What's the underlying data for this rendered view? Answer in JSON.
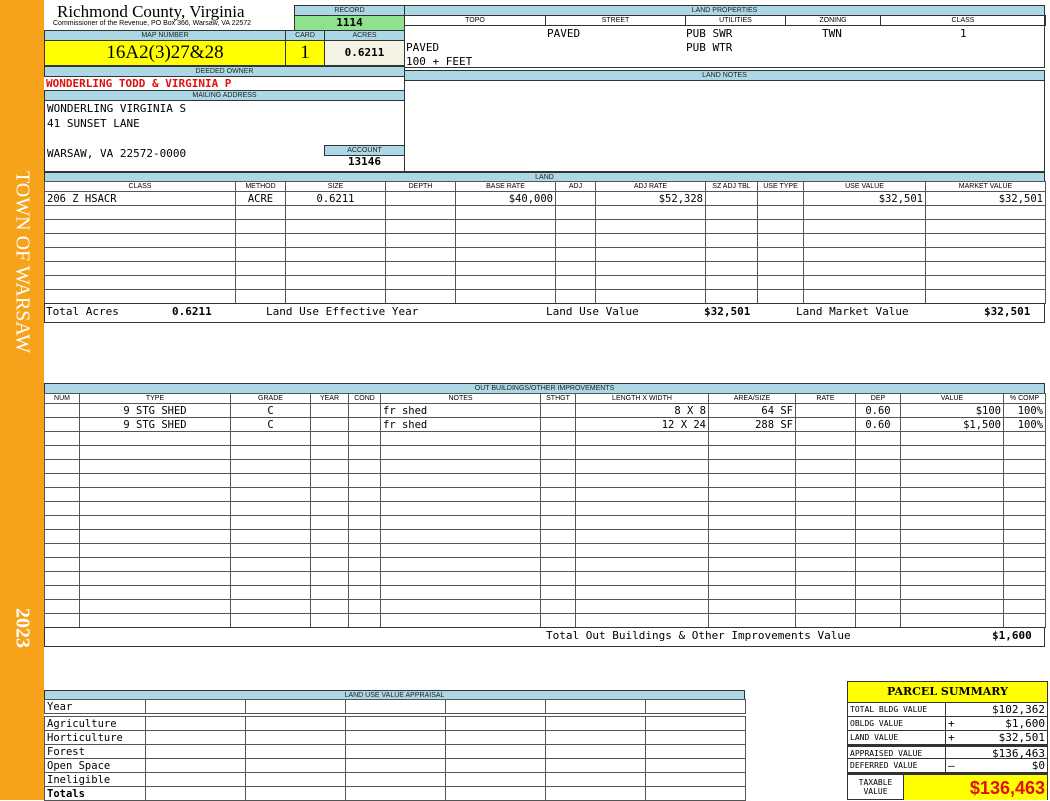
{
  "sidebar": {
    "town": "TOWN OF WARSAW",
    "year": "2023",
    "color": "#f7a21b"
  },
  "header": {
    "county": "Richmond County, Virginia",
    "subtitle": "Commissioner of the Revenue, PO Box 366, Warsaw, VA 22572"
  },
  "record": {
    "label": "RECORD",
    "value": "1114"
  },
  "map": {
    "label": "MAP NUMBER",
    "value": "16A2(3)27&28"
  },
  "card": {
    "label": "CARD",
    "value": "1"
  },
  "acres": {
    "label": "ACRES",
    "value": "0.6211"
  },
  "owner": {
    "label": "DEEDED OWNER",
    "value": "WONDERLING TODD & VIRGINIA P"
  },
  "mailing": {
    "label": "MAILING ADDRESS",
    "lines": [
      "WONDERLING VIRGINIA S",
      "41 SUNSET LANE",
      "",
      "WARSAW, VA 22572-0000"
    ]
  },
  "account": {
    "label": "ACCOUNT",
    "value": "13146"
  },
  "land_properties": {
    "label": "LAND PROPERTIES",
    "columns": [
      "TOPO",
      "STREET",
      "UTILITIES",
      "ZONING",
      "CLASS"
    ],
    "street": "PAVED",
    "utilities": [
      "PUB SWR",
      "PUB WTR"
    ],
    "zoning": "TWN",
    "class": "1",
    "topo": [
      "PAVED",
      "100 + FEET"
    ]
  },
  "land_notes": {
    "label": "LAND NOTES"
  },
  "land": {
    "label": "LAND",
    "columns": [
      "CLASS",
      "METHOD",
      "SIZE",
      "DEPTH",
      "BASE RATE",
      "ADJ",
      "ADJ RATE",
      "SZ ADJ TBL",
      "USE TYPE",
      "USE VALUE",
      "MARKET VALUE"
    ],
    "rows": [
      [
        "206 Z HSACR",
        "ACRE",
        "0.6211",
        "",
        "$40,000",
        "",
        "$52,328",
        "",
        "",
        "$32,501",
        "$32,501"
      ]
    ],
    "totals": {
      "acres_label": "Total Acres",
      "acres": "0.6211",
      "eff_year_label": "Land Use Effective Year",
      "eff_year": "",
      "use_value_label": "Land Use Value",
      "use_value": "$32,501",
      "market_label": "Land Market Value",
      "market": "$32,501"
    }
  },
  "outbuildings": {
    "label": "OUT BUILDINGS/OTHER IMPROVEMENTS",
    "columns": [
      "NUM",
      "TYPE",
      "GRADE",
      "YEAR",
      "COND",
      "NOTES",
      "STHGT",
      "LENGTH X WIDTH",
      "AREA/SIZE",
      "RATE",
      "DEP",
      "VALUE",
      "% COMP"
    ],
    "rows": [
      [
        "",
        "9 STG SHED",
        "C",
        "",
        "",
        "fr shed",
        "",
        "8 X 8",
        "64 SF",
        "",
        "0.60",
        "$100",
        "100%"
      ],
      [
        "",
        "9 STG SHED",
        "C",
        "",
        "",
        "fr shed",
        "",
        "12 X 24",
        "288 SF",
        "",
        "0.60",
        "$1,500",
        "100%"
      ]
    ],
    "total_label": "Total Out Buildings & Other Improvements Value",
    "total": "$1,600"
  },
  "land_use_appraisal": {
    "label": "LAND USE VALUE APPRAISAL",
    "year_label": "Year",
    "rows": [
      "Agriculture",
      "Horticulture",
      "Forest",
      "Open Space",
      "Ineligible"
    ],
    "totals_label": "Totals"
  },
  "parcel_summary": {
    "title": "PARCEL SUMMARY",
    "rows": [
      {
        "label": "TOTAL BLDG VALUE",
        "sign": "",
        "value": "$102,362"
      },
      {
        "label": "OBLDG VALUE",
        "sign": "+",
        "value": "$1,600"
      },
      {
        "label": "LAND VALUE",
        "sign": "+",
        "value": "$32,501"
      },
      {
        "label": "APPRAISED VALUE",
        "sign": "",
        "value": "$136,463"
      },
      {
        "label": "DEFERRED VALUE",
        "sign": "–",
        "value": "$0"
      }
    ],
    "taxable_label": "TAXABLE VALUE",
    "taxable": "$136,463"
  }
}
